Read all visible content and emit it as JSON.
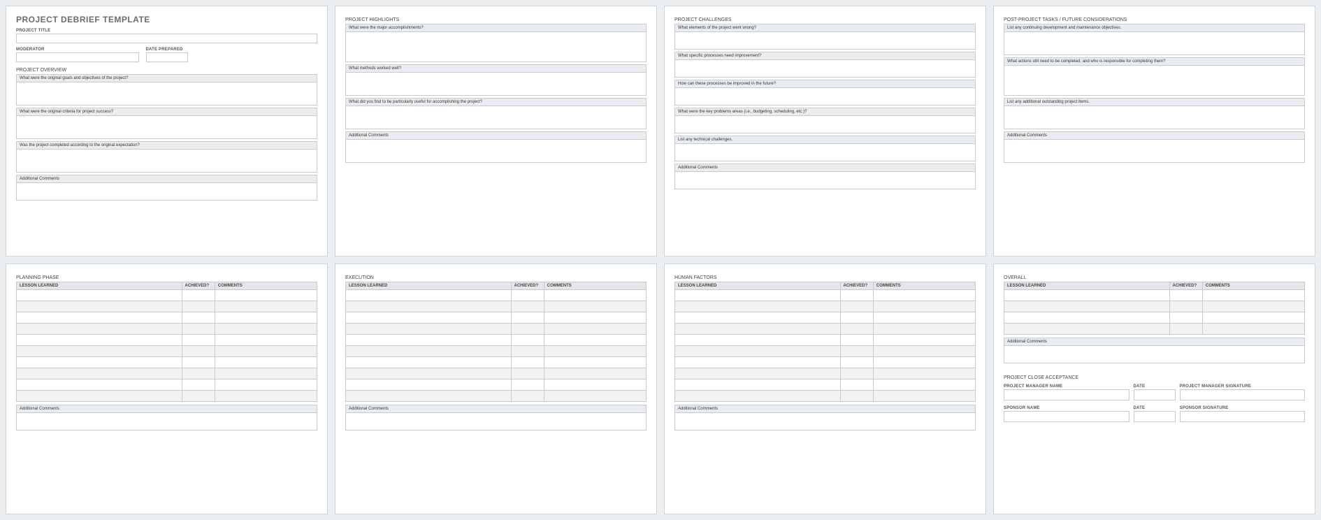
{
  "page1": {
    "title": "PROJECT DEBRIEF TEMPLATE",
    "project_title_label": "PROJECT TITLE",
    "moderator_label": "MODERATOR",
    "date_prepared_label": "DATE PREPARED",
    "overview_label": "PROJECT OVERVIEW",
    "q1": "What were the original goals and objectives of the project?",
    "q2": "What were the original criteria for project success?",
    "q3": "Was the project completed according to the original expectation?",
    "additional": "Additional Comments"
  },
  "page2": {
    "section": "PROJECT HIGHLIGHTS",
    "q1": "What were the major accomplishments?",
    "q2": "What methods worked well?",
    "q3": "What did you find to be particularly useful for accomplishing the project?",
    "additional": "Additional Comments"
  },
  "page3": {
    "section": "PROJECT CHALLENGES",
    "q1": "What elements of the project went wrong?",
    "q2": "What specific processes need improvement?",
    "q3": "How can these processes be improved in the future?",
    "q4": "What were the key problems areas (i.e., budgeting, scheduling, etc.)?",
    "q5": "List any technical challenges.",
    "additional": "Additional Comments"
  },
  "page4": {
    "section": "POST-PROJECT TASKS / FUTURE CONSIDERATIONS",
    "q1": "List any continuing development and maintenance objectives.",
    "q2": "What actions still need to be completed, and who is responsible for completing them?",
    "q3": "List any additional outstanding project items.",
    "additional": "Additional Comments"
  },
  "page5": {
    "section": "PLANNING PHASE",
    "th_lesson": "LESSON LEARNED",
    "th_achieved": "ACHIEVED?",
    "th_comments": "COMMENTS",
    "additional": "Additional Comments"
  },
  "page6": {
    "section": "EXECUTION",
    "th_lesson": "LESSON LEARNED",
    "th_achieved": "ACHIEVED?",
    "th_comments": "COMMENTS",
    "additional": "Additional Comments"
  },
  "page7": {
    "section": "HUMAN FACTORS",
    "th_lesson": "LESSON LEARNED",
    "th_achieved": "ACHIEVED?",
    "th_comments": "COMMENTS",
    "additional": "Additional Comments"
  },
  "page8": {
    "overall_section": "OVERALL",
    "th_lesson": "LESSON LEARNED",
    "th_achieved": "ACHIEVED?",
    "th_comments": "COMMENTS",
    "additional": "Additional Comments",
    "close_section": "PROJECT CLOSE ACCEPTANCE",
    "pm_name": "PROJECT MANAGER NAME",
    "date": "DATE",
    "pm_sig": "PROJECT MANAGER SIGNATURE",
    "sponsor_name": "SPONSOR NAME",
    "sponsor_sig": "SPONSOR SIGNATURE"
  }
}
